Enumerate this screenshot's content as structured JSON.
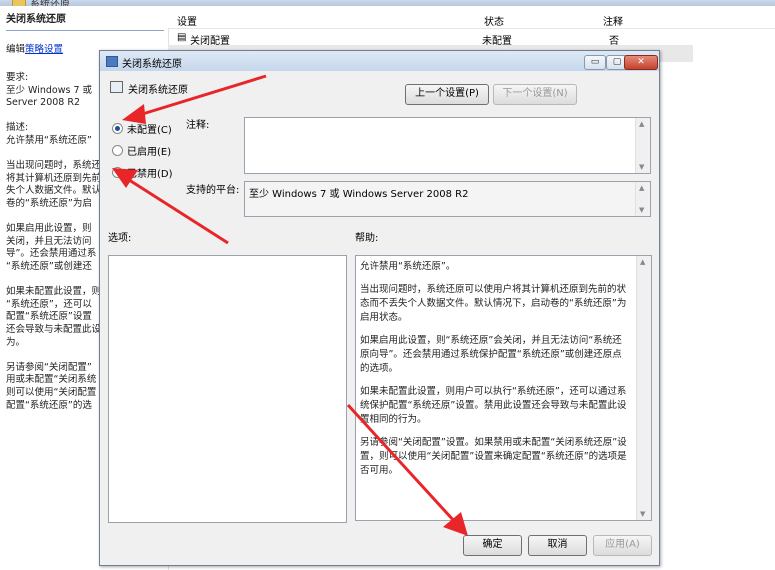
{
  "background_window": {
    "title": "系统还原",
    "left_pane": {
      "title": "关闭系统还原",
      "edit_prefix": "编辑",
      "edit_link": "策略设置",
      "lines": [
        "要求:",
        "至少 Windows 7 或",
        "Server 2008 R2",
        "",
        "描述:",
        "允许禁用“系统还原”",
        "",
        "当出现问题时，系统还",
        "将其计算机还原到先前",
        "失个人数据文件。默认",
        "卷的“系统还原”为启",
        "",
        "如果启用此设置，则",
        "关闭，并且无法访问",
        "导”。还会禁用通过系",
        "“系统还原”或创建还",
        "",
        "如果未配置此设置，则",
        "“系统还原”，还可以",
        "配置“系统还原”设置",
        "还会导致与未配置此设",
        "为。",
        "",
        "另请参阅“关闭配置”",
        "用或未配置“关闭系统",
        "则可以使用“关闭配置",
        "配置“系统还原”的选"
      ]
    },
    "columns": {
      "setting": "设置",
      "state": "状态",
      "comment": "注释"
    },
    "rows": [
      {
        "setting": "关闭配置",
        "state": "未配置",
        "comment": "否"
      }
    ]
  },
  "dialog": {
    "title": "关闭系统还原",
    "subtitle": "关闭系统还原",
    "titlebar_buttons": [
      "▭",
      "▢",
      "✕"
    ],
    "prev_button": "上一个设置(P)",
    "next_button": "下一个设置(N)",
    "radios": [
      {
        "label": "未配置(C)",
        "checked": true
      },
      {
        "label": "已启用(E)",
        "checked": false
      },
      {
        "label": "已禁用(D)",
        "checked": false
      }
    ],
    "comment_label": "注释:",
    "comment_value": "",
    "platform_label": "支持的平台:",
    "platform_value": "至少 Windows 7 或 Windows Server 2008 R2",
    "options_label": "选项:",
    "help_label": "帮助:",
    "help_paragraphs": [
      "允许禁用“系统还原”。",
      "当出现问题时，系统还原可以使用户将其计算机还原到先前的状态而不丢失个人数据文件。默认情况下，启动卷的“系统还原”为启用状态。",
      "如果启用此设置，则“系统还原”会关闭，并且无法访问“系统还原向导”。还会禁用通过系统保护配置“系统还原”或创建还原点的选项。",
      "如果未配置此设置，则用户可以执行“系统还原”，还可以通过系统保护配置“系统还原”设置。禁用此设置还会导致与未配置此设置相同的行为。",
      "另请参阅“关闭配置”设置。如果禁用或未配置“关闭系统还原”设置，则可以使用“关闭配置”设置来确定配置“系统还原”的选项是否可用。"
    ],
    "ok_button": "确定",
    "cancel_button": "取消",
    "apply_button": "应用(A)",
    "annotation_color": "#e8262a"
  }
}
